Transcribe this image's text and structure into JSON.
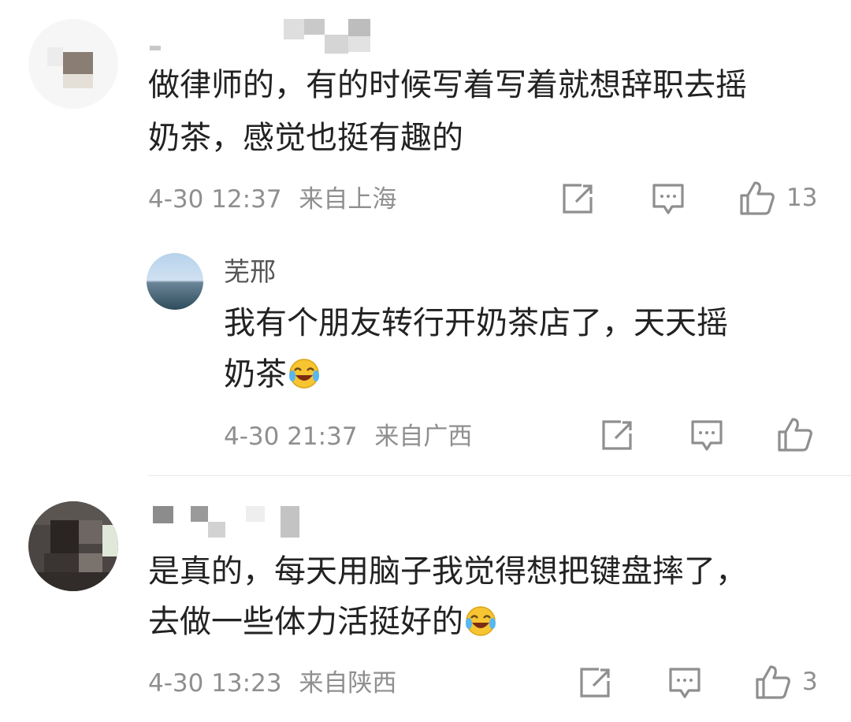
{
  "comments": [
    {
      "text_line1": "做律师的，有的时候写着写着就想辞职去摇",
      "text_line2": "奶茶，感觉也挺有趣的",
      "date": "4-30 12:37",
      "location": "来自上海",
      "likes": "13",
      "reply": {
        "username": "芜邢",
        "text_line1": "我有个朋友转行开奶茶店了，天天摇",
        "text_line2": "奶茶",
        "date": "4-30 21:37",
        "location": "来自广西"
      }
    },
    {
      "text_line1": "是真的，每天用脑子我觉得想把键盘摔了，",
      "text_line2": "去做一些体力活挺好的",
      "date": "4-30 13:23",
      "location": "来自陕西",
      "likes": "3"
    }
  ],
  "icons": {
    "share": "share-icon",
    "comment": "comment-icon",
    "like": "thumbs-up-icon",
    "emoji": "laughing-crying-emoji-icon"
  },
  "colors": {
    "text": "#222222",
    "meta": "#8f8f8f",
    "reply_name": "#555555",
    "icon": "#8f8f8f",
    "divider": "#e9e9e9",
    "emoji_face": "#f7c531"
  }
}
